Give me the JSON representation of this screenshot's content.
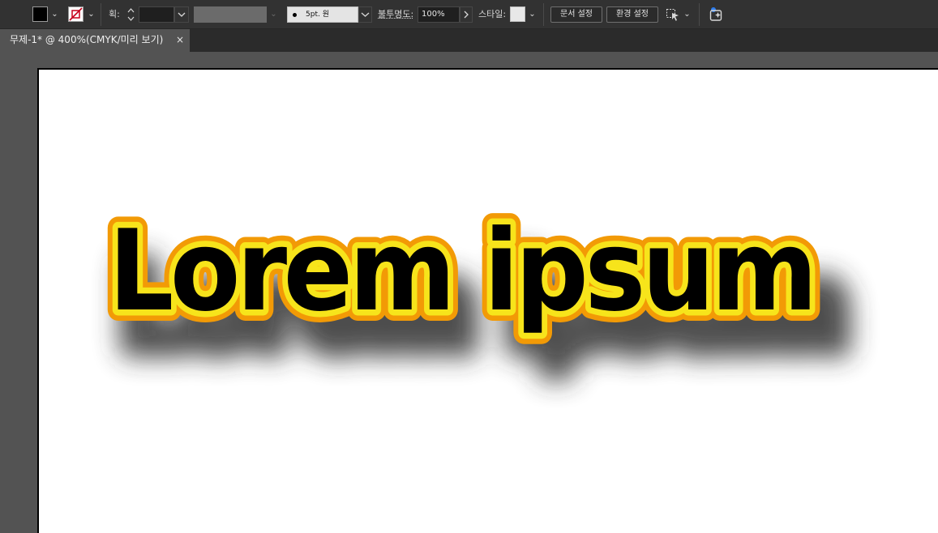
{
  "toolbar": {
    "fill_color": "#000000",
    "stroke_color": "none",
    "stroke_label": "획:",
    "brush": {
      "value": "5pt. 원"
    },
    "opacity": {
      "label": "불투명도:",
      "value": "100%"
    },
    "style_label": "스타일:",
    "document_setup_label": "문서 설정",
    "preferences_label": "환경 설정"
  },
  "tab": {
    "title": "무제-1* @ 400%(CMYK/미리 보기)",
    "close": "×"
  },
  "artwork": {
    "text": "Lorem ipsum",
    "fill_color": "#000000",
    "inner_stroke_color": "#f7e41b",
    "outer_stroke_color": "#f29a06",
    "shadow_color": "#3a3a3a"
  }
}
